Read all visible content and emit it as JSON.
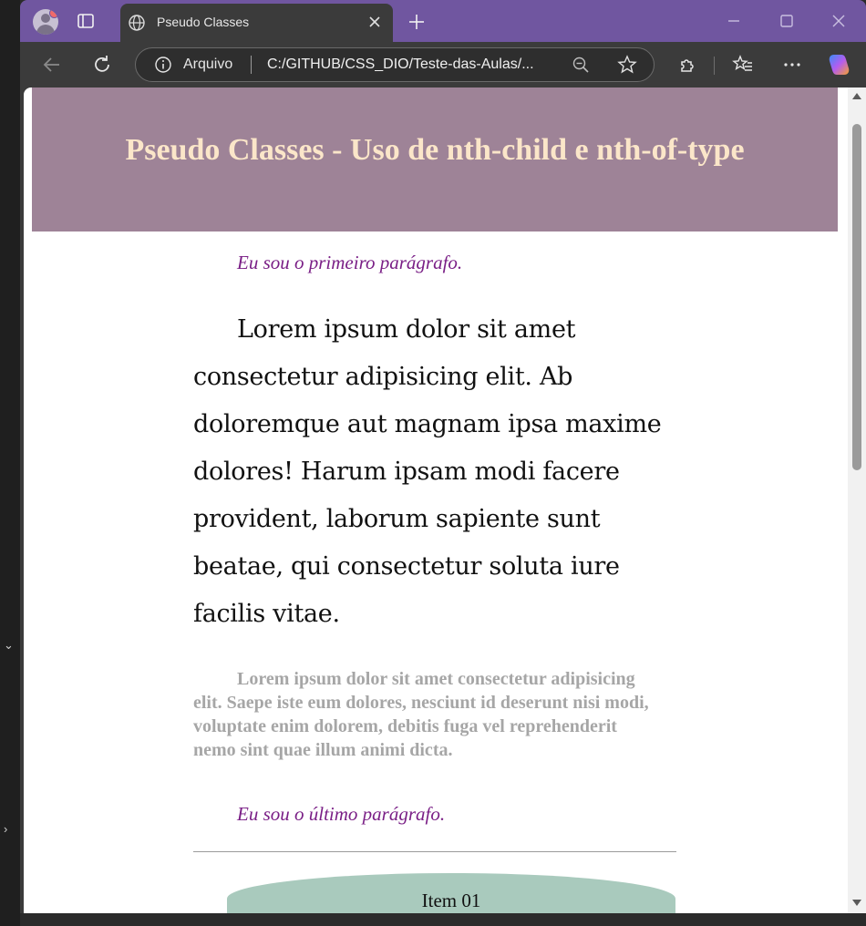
{
  "browser": {
    "tab_title": "Pseudo Classes",
    "address_scheme": "Arquivo",
    "address_url": "C:/GITHUB/CSS_DIO/Teste-das-Aulas/..."
  },
  "page": {
    "heading": "Pseudo Classes - Uso de nth-child e nth-of-type",
    "paragraph_first": "Eu sou o primeiro parágrafo.",
    "paragraph_lorem_1": "Lorem ipsum dolor sit amet consectetur adipisicing elit. Ab doloremque aut magnam ipsa maxime dolores! Harum ipsam modi facere provident, laborum sapiente sunt beatae, qui consectetur soluta iure facilis vitae.",
    "paragraph_lorem_2": "Lorem ipsum dolor sit amet consectetur adipisicing elit. Saepe iste eum dolores, nesciunt id deserunt nisi modi, voluptate enim dolorem, debitis fuga vel reprehenderit nemo sint quae illum animi dicta.",
    "paragraph_last": "Eu sou o último parágrafo.",
    "list_items": [
      "Item 01"
    ]
  },
  "colors": {
    "titlebar": "#7056a0",
    "header_bg": "#9e8397",
    "heading_text": "#fbe6c9",
    "accent_paragraph": "#7a1f86",
    "muted_paragraph": "#a6a6a6",
    "list_item_bg": "#a9cabd"
  },
  "icons": [
    "profile-avatar-icon",
    "tab-actions-icon",
    "globe-icon",
    "close-icon",
    "new-tab-icon",
    "minimize-icon",
    "maximize-icon",
    "window-close-icon",
    "back-icon",
    "reload-icon",
    "info-icon",
    "zoom-out-icon",
    "favorite-star-icon",
    "extensions-icon",
    "favorites-icon",
    "more-menu-icon",
    "copilot-icon"
  ]
}
